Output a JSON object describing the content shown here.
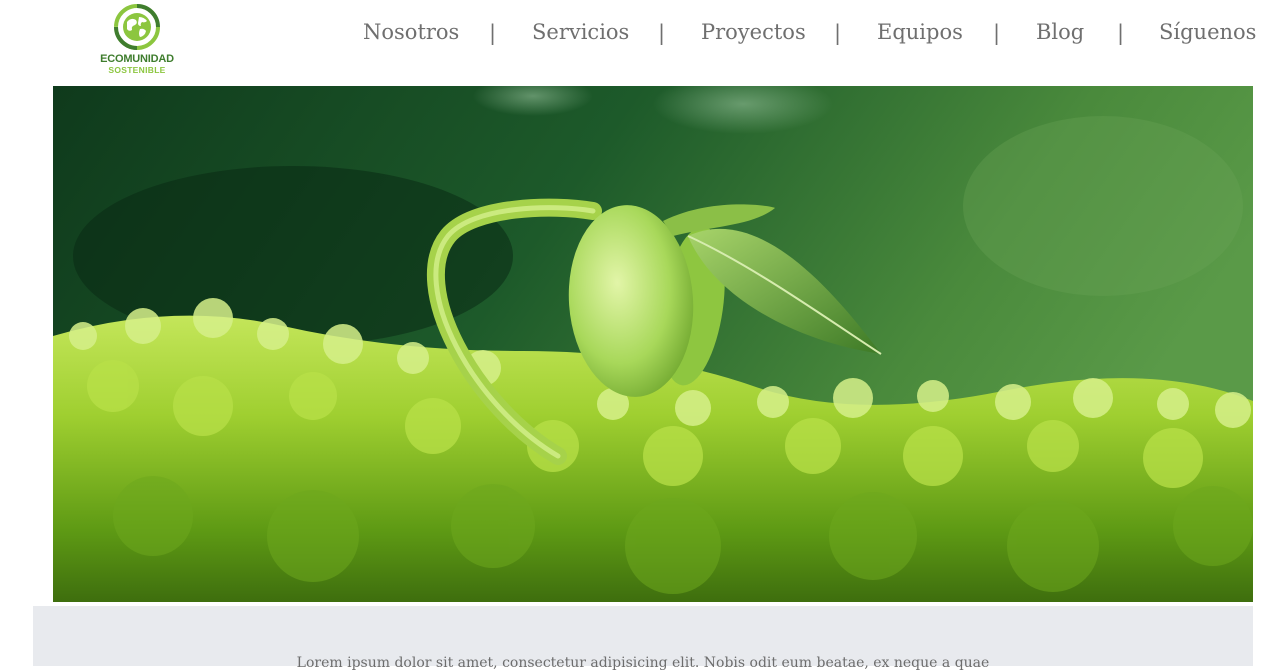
{
  "brand": {
    "logo_icon": "globe-recycle-icon",
    "name": "ECOMUNIDAD",
    "tagline": "SOSTENIBLE",
    "colors": {
      "dark_green": "#3f7d2e",
      "light_green": "#8cc63f"
    }
  },
  "nav": {
    "separator": "|",
    "items": [
      {
        "label": "Nosotros"
      },
      {
        "label": "Servicios"
      },
      {
        "label": "Proyectos"
      },
      {
        "label": "Equipos"
      },
      {
        "label": "Blog"
      },
      {
        "label": "Síguenos"
      }
    ]
  },
  "hero": {
    "image": "sprouting-seed-on-moss"
  },
  "intro": {
    "text": "Lorem ipsum dolor sit amet, consectetur adipisicing elit. Nobis odit eum beatae, ex neque a quae"
  },
  "colors": {
    "nav_text": "#6f6f6f",
    "band_bg": "#e8eaee"
  }
}
